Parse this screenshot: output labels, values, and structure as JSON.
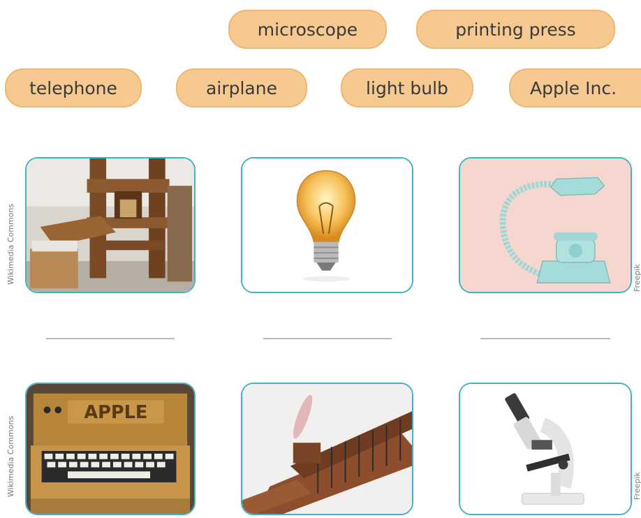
{
  "word_bank": {
    "microscope": "microscope",
    "printing_press": "printing press",
    "telephone": "telephone",
    "airplane": "airplane",
    "light_bulb": "light bulb",
    "apple": "Apple Inc."
  },
  "pictures": {
    "row1": [
      "printing-press-photo",
      "light-bulb-photo",
      "telephone-photo"
    ],
    "row2": [
      "apple-computer-photo",
      "airplane-photo",
      "microscope-photo"
    ]
  },
  "image_text": {
    "apple_sign": "APPLE"
  },
  "credits": {
    "left_top": "Wikimedia Commons",
    "left_bottom": "Wikimedia Commons",
    "right_top": "Freepik",
    "right_bottom": "Freepik"
  },
  "colors": {
    "chip_fill": "#f5c98f",
    "chip_border": "#efb66f",
    "card_border": "#47b0c4",
    "answer_line": "#b8b8b8"
  }
}
